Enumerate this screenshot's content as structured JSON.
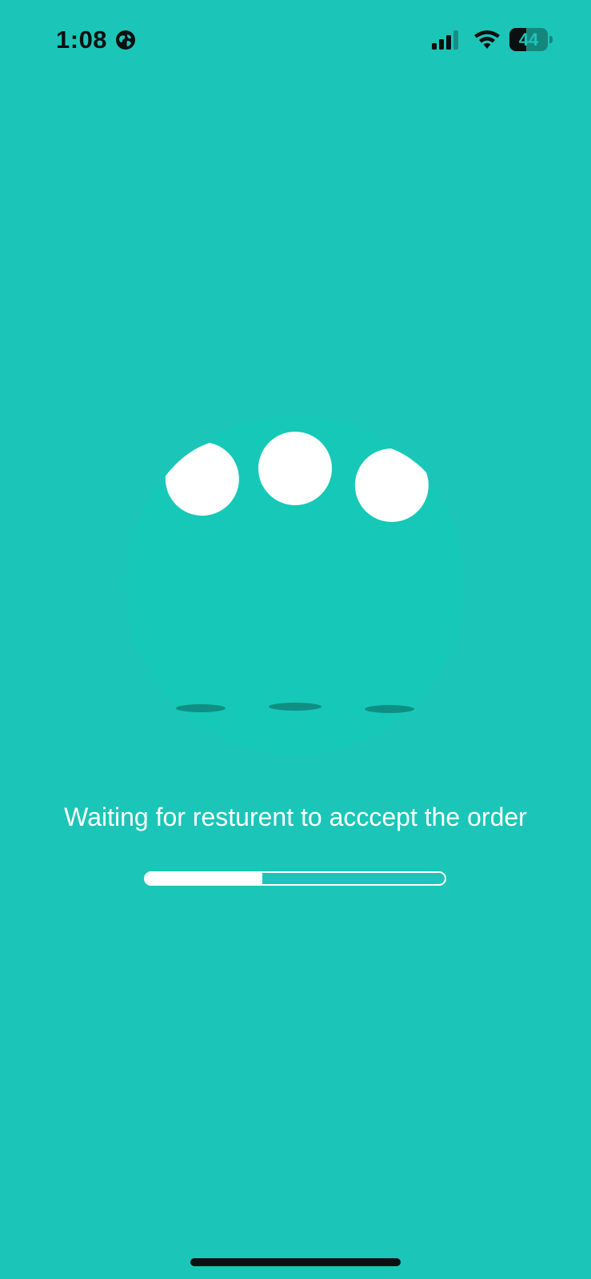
{
  "status_bar": {
    "time": "1:08",
    "battery_level": "44",
    "icons": [
      "globe-icon",
      "signal-icon",
      "wifi-icon",
      "battery-icon"
    ]
  },
  "loader": {
    "icon": "loading-dots-icon",
    "circle_color": "#17c7b8",
    "dot_color": "#ffffff",
    "shadow_color": "#0f8f84"
  },
  "message": "Waiting for resturent to acccept the order",
  "progress": {
    "fraction": 0.39
  },
  "colors": {
    "background": "#1bc6b8",
    "foreground": "#ffffff",
    "status_text": "#0b0f0f"
  }
}
